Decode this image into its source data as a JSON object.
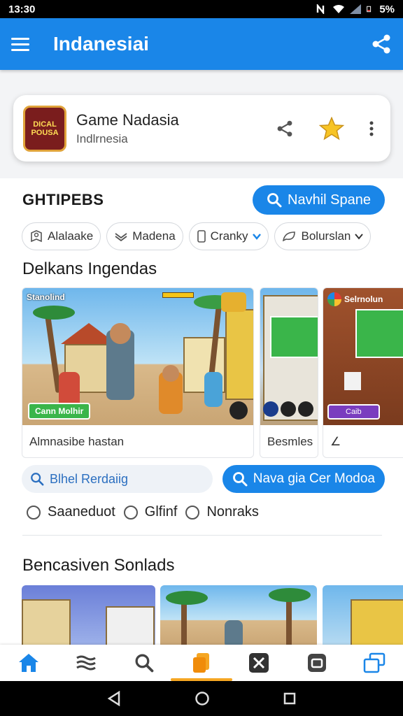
{
  "status_bar": {
    "time": "13:30",
    "battery": "5%"
  },
  "app_bar": {
    "title": "Indanesiai"
  },
  "top_card": {
    "logo_text": "DICAL POUSA",
    "title": "Game Nadasia",
    "subtitle": "Indlrnesia"
  },
  "filters_section": {
    "heading": "GHTIPEBS",
    "action_button": "Navhil Spane",
    "chips": [
      "Alalaake",
      "Madena",
      "Cranky",
      "Bolurslan"
    ]
  },
  "featured": {
    "title": "Delkans Ingendas",
    "cards": [
      {
        "badge": "Stanolind",
        "banner": "Cann Molhir",
        "caption": "Almnasibe hastan"
      },
      {
        "caption": "Besmles"
      },
      {
        "badge": "Selrnolun",
        "banner": "Caib",
        "caption": "∠"
      }
    ]
  },
  "search": {
    "field_text": "Blhel Rerdaiig",
    "button_label": "Nava gia Cer Modoa"
  },
  "radio_options": [
    "Saaneduot",
    "Glfinf",
    "Nonraks"
  ],
  "bottom_section": {
    "title": "Bencasiven Sonlads"
  },
  "bottom_nav": [
    "home-icon",
    "waves-icon",
    "search-icon",
    "bookmark-icon",
    "tools-icon",
    "window-icon",
    "tabs-icon"
  ],
  "colors": {
    "primary": "#1a86e8",
    "accent": "#f5a623"
  }
}
